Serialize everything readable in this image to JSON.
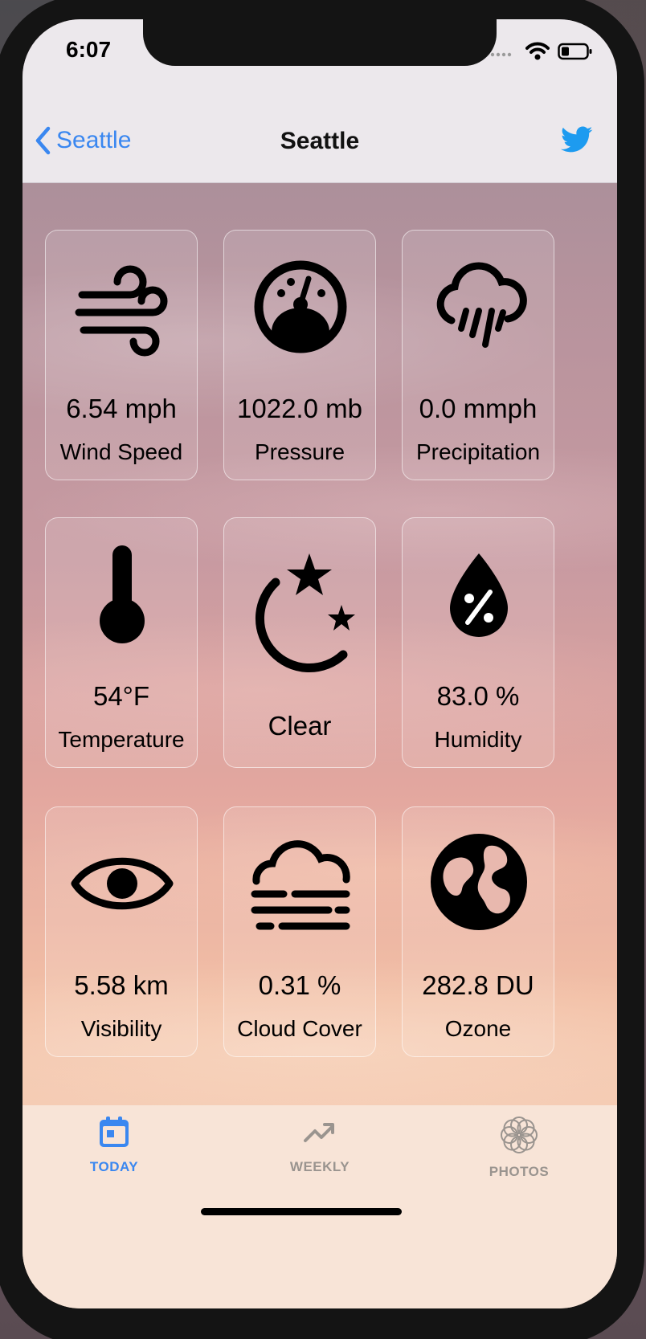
{
  "status_bar": {
    "time": "6:07"
  },
  "nav": {
    "back_label": "Seattle",
    "title": "Seattle"
  },
  "colors": {
    "accent": "#3a87f0",
    "twitter": "#1d9bf0",
    "inactive": "#9a948f"
  },
  "cards": [
    {
      "icon": "wind-icon",
      "value": "6.54 mph",
      "label": "Wind Speed"
    },
    {
      "icon": "pressure-gauge-icon",
      "value": "1022.0 mb",
      "label": "Pressure"
    },
    {
      "icon": "cloud-rain-icon",
      "value": "0.0 mmph",
      "label": "Precipitation"
    },
    {
      "icon": "thermometer-icon",
      "value": "54°F",
      "label": "Temperature"
    },
    {
      "icon": "moon-stars-icon",
      "value": "Clear",
      "label": ""
    },
    {
      "icon": "humidity-drop-icon",
      "value": "83.0 %",
      "label": "Humidity"
    },
    {
      "icon": "eye-icon",
      "value": "5.58 km",
      "label": "Visibility"
    },
    {
      "icon": "cloud-fog-icon",
      "value": "0.31 %",
      "label": "Cloud Cover"
    },
    {
      "icon": "globe-icon",
      "value": "282.8 DU",
      "label": "Ozone"
    }
  ],
  "tabs": [
    {
      "label": "TODAY",
      "icon": "calendar-icon",
      "active": true
    },
    {
      "label": "WEEKLY",
      "icon": "trend-icon",
      "active": false
    },
    {
      "label": "PHOTOS",
      "icon": "flower-icon",
      "active": false
    }
  ]
}
